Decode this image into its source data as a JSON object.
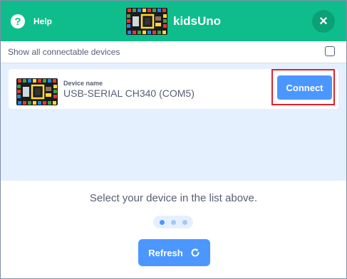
{
  "header": {
    "help_label": "Help",
    "help_glyph": "?",
    "title": "kidsUno",
    "board_icon": "circuit-board-icon",
    "close_glyph": "×"
  },
  "options": {
    "show_all_label": "Show all connectable devices",
    "show_all_checked": false
  },
  "devices": [
    {
      "caption": "Device name",
      "name": "USB-SERIAL CH340 (COM5)",
      "connect_label": "Connect"
    }
  ],
  "footer": {
    "hint": "Select your device in the list above.",
    "step_active": 1,
    "step_count": 3,
    "refresh_label": "Refresh"
  },
  "colors": {
    "header": "#0fbd8c",
    "accent": "#4c97ff",
    "list_bg": "#e5f0ff",
    "highlight": "#e0212d",
    "text": "#575e75"
  }
}
